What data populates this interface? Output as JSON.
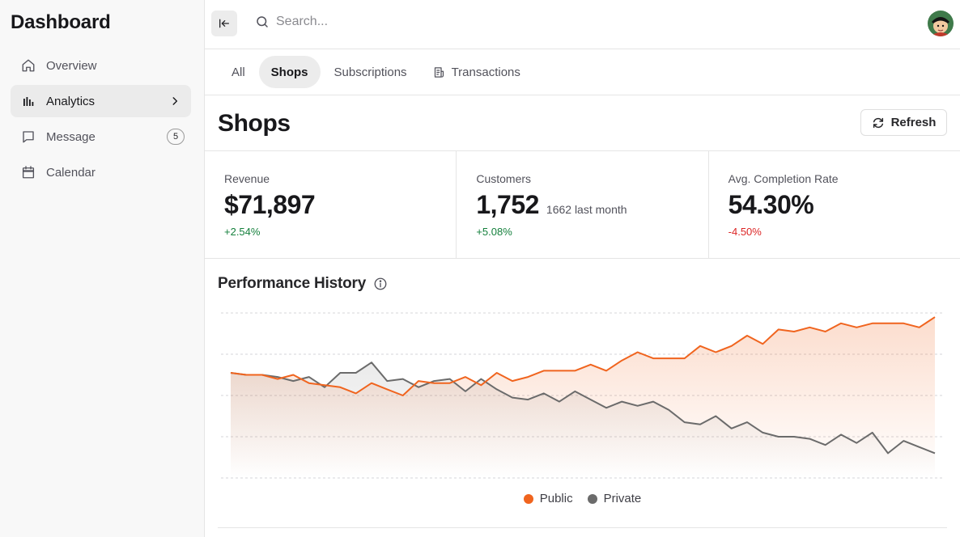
{
  "sidebar": {
    "title": "Dashboard",
    "items": [
      {
        "label": "Overview",
        "icon": "home-icon"
      },
      {
        "label": "Analytics",
        "icon": "bar-chart-icon",
        "active": true
      },
      {
        "label": "Message",
        "icon": "message-icon",
        "badge": "5"
      },
      {
        "label": "Calendar",
        "icon": "calendar-icon"
      }
    ]
  },
  "topbar": {
    "search_placeholder": "Search..."
  },
  "tabs": [
    {
      "label": "All"
    },
    {
      "label": "Shops",
      "active": true
    },
    {
      "label": "Subscriptions"
    },
    {
      "label": "Transactions",
      "icon": "receipt-icon"
    }
  ],
  "page": {
    "title": "Shops",
    "refresh_label": "Refresh"
  },
  "stats": [
    {
      "label": "Revenue",
      "value": "$71,897",
      "sub": "",
      "change": "+2.54%",
      "trend": "up"
    },
    {
      "label": "Customers",
      "value": "1,752",
      "sub": "1662 last month",
      "change": "+5.08%",
      "trend": "up"
    },
    {
      "label": "Avg. Completion Rate",
      "value": "54.30%",
      "sub": "",
      "change": "-4.50%",
      "trend": "down"
    }
  ],
  "performance": {
    "title": "Performance History"
  },
  "colors": {
    "public": "#f0641e",
    "private": "#6b6b6b",
    "up": "#15803d",
    "down": "#dc2626"
  },
  "chart_data": {
    "type": "area",
    "grid": true,
    "legend": "bottom",
    "series": [
      {
        "name": "Public",
        "values": [
          51,
          50,
          50,
          48,
          50,
          46,
          45,
          44,
          41,
          46,
          43,
          40,
          47,
          46,
          46,
          49,
          45,
          51,
          47,
          49,
          52,
          52,
          52,
          55,
          52,
          57,
          61,
          58,
          58,
          58,
          64,
          61,
          64,
          69,
          65,
          72,
          71,
          73,
          71,
          75,
          73,
          75,
          75,
          75,
          73,
          78
        ]
      },
      {
        "name": "Private",
        "values": [
          51,
          50,
          50,
          49,
          47,
          49,
          44,
          51,
          51,
          56,
          47,
          48,
          44,
          47,
          48,
          42,
          48,
          43,
          39,
          38,
          41,
          37,
          42,
          38,
          34,
          37,
          35,
          37,
          33,
          27,
          26,
          30,
          24,
          27,
          22,
          20,
          20,
          19,
          16,
          21,
          17,
          22,
          12,
          18,
          15,
          12
        ]
      }
    ]
  }
}
